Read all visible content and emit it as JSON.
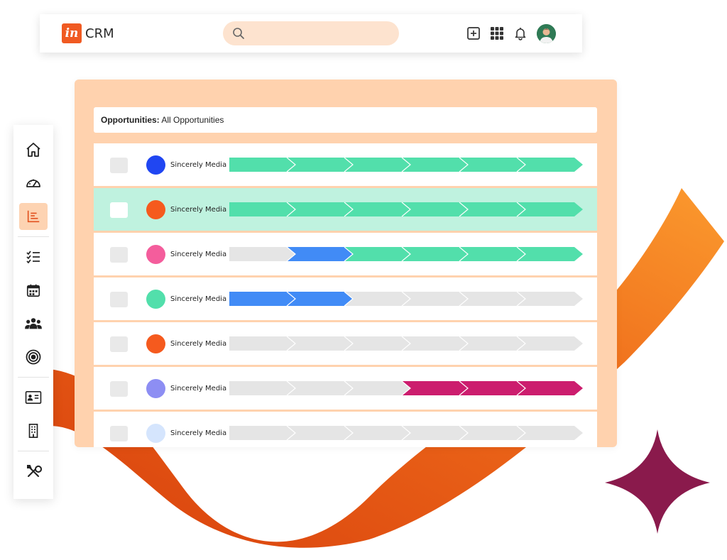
{
  "app": {
    "logo_mark": "in",
    "logo_text": "CRM"
  },
  "search": {
    "placeholder": ""
  },
  "header_icons": [
    "add-box-icon",
    "apps-grid-icon",
    "bell-icon",
    "user-avatar"
  ],
  "sidebar": {
    "items": [
      {
        "name": "home-icon",
        "active": false
      },
      {
        "name": "dashboard-gauge-icon",
        "active": false
      },
      {
        "name": "reports-chart-icon",
        "active": true
      },
      {
        "name": "tasks-checklist-icon",
        "active": false
      },
      {
        "name": "calendar-icon",
        "active": false
      },
      {
        "name": "contacts-people-icon",
        "active": false
      },
      {
        "name": "target-icon",
        "active": false
      },
      {
        "name": "contact-card-icon",
        "active": false
      },
      {
        "name": "building-icon",
        "active": false
      },
      {
        "name": "tools-icon",
        "active": false
      }
    ]
  },
  "panel": {
    "title_bold": "Opportunities:",
    "title_rest": " All Opportunities"
  },
  "colors": {
    "accent": "#f05a22",
    "stage_won": "#52dfab",
    "stage_active": "#418bf6",
    "stage_lost": "#cc1d6e",
    "stage_empty": "#e5e5e5",
    "selected_row": "#bff2df",
    "panel_bg": "#ffd2ae"
  },
  "rows": [
    {
      "company": "Sincerely Media",
      "dot": "#2046f2",
      "selected": false,
      "stages": [
        "g",
        "g",
        "g",
        "g",
        "g",
        "g"
      ]
    },
    {
      "company": "Sincerely Media",
      "dot": "#f55a1e",
      "selected": true,
      "stages": [
        "g",
        "g",
        "g",
        "g",
        "g",
        "g"
      ]
    },
    {
      "company": "Sincerely Media",
      "dot": "#f45d9c",
      "selected": false,
      "stages": [
        "e",
        "b",
        "g",
        "g",
        "g",
        "g"
      ]
    },
    {
      "company": "Sincerely Media",
      "dot": "#52dfab",
      "selected": false,
      "stages": [
        "b",
        "b",
        "e",
        "e",
        "e",
        "e"
      ]
    },
    {
      "company": "Sincerely Media",
      "dot": "#f55a1e",
      "selected": false,
      "stages": [
        "e",
        "e",
        "e",
        "e",
        "e",
        "e"
      ]
    },
    {
      "company": "Sincerely Media",
      "dot": "#8d8ef3",
      "selected": false,
      "stages": [
        "e",
        "e",
        "e",
        "m",
        "m",
        "m"
      ]
    },
    {
      "company": "Sincerely Media",
      "dot": "#d5e5fd",
      "selected": false,
      "stages": [
        "e",
        "e",
        "e",
        "e",
        "e",
        "e"
      ]
    }
  ]
}
